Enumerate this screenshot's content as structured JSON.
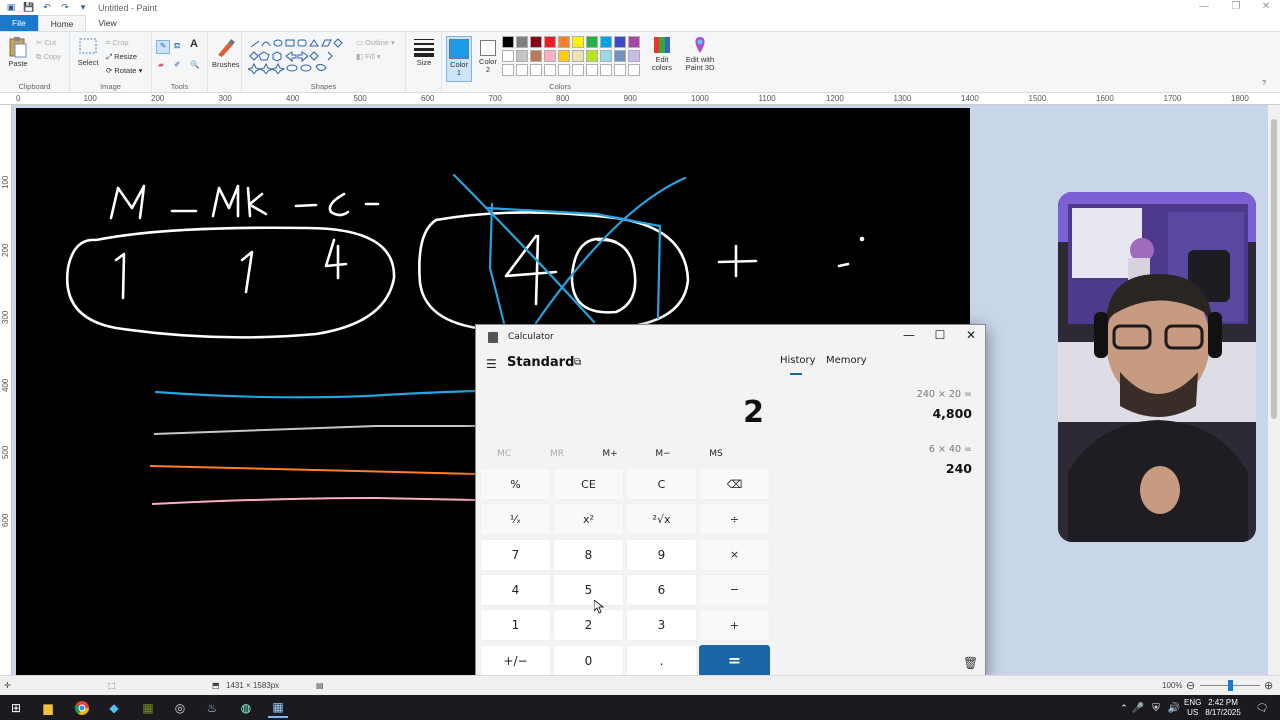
{
  "window_title": "Untitled - Paint",
  "ribbon": {
    "tabs": [
      "File",
      "Home",
      "View"
    ],
    "clipboard": {
      "paste": "Paste",
      "cut": "Cut",
      "copy": "Copy",
      "label": "Clipboard"
    },
    "image": {
      "select": "Select",
      "crop": "Crop",
      "resize": "Resize",
      "rotate": "Rotate",
      "label": "Image"
    },
    "tools": {
      "label": "Tools"
    },
    "brushes": {
      "label": "Brushes"
    },
    "shapes": {
      "outline": "Outline",
      "fill": "Fill",
      "label": "Shapes"
    },
    "size": {
      "label": "Size"
    },
    "color1": {
      "label": "Color",
      "num": "1"
    },
    "color2": {
      "label": "Color",
      "num": "2"
    },
    "colors": {
      "label": "Colors",
      "edit": "Edit colors",
      "paint3d": "Edit with Paint 3D"
    },
    "palette_row1": [
      "#000000",
      "#7f7f7f",
      "#880015",
      "#ed1c24",
      "#ff7f27",
      "#fff200",
      "#22b14c",
      "#00a2e8",
      "#3f48cc",
      "#a349a4"
    ],
    "palette_row2": [
      "#ffffff",
      "#c3c3c3",
      "#b97a57",
      "#ffaec9",
      "#ffc90e",
      "#efe4b0",
      "#b5e61d",
      "#99d9ea",
      "#7092be",
      "#c8bfe7"
    ],
    "color1_value": "#1e9be6",
    "color2_value": "#ffffff"
  },
  "ruler_h_ticks": [
    "0",
    "100",
    "200",
    "300",
    "400",
    "500",
    "600",
    "700",
    "800",
    "900",
    "1000",
    "1100",
    "1200",
    "1300",
    "1400",
    "1500",
    "1600",
    "1700",
    "1800"
  ],
  "ruler_v_ticks": [
    "100",
    "200",
    "300",
    "400",
    "500",
    "600"
  ],
  "canvas_handwriting": {
    "top_text": "M — Mk — C —",
    "digits_left": [
      "1",
      "1",
      "4"
    ],
    "digits_right": "40",
    "plus": "+"
  },
  "status": {
    "canvas_size": "1431 × 1583px",
    "zoom": "100%"
  },
  "calculator": {
    "title": "Calculator",
    "mode": "Standard",
    "display": "2",
    "memory_buttons": [
      "MC",
      "MR",
      "M+",
      "M−",
      "MS"
    ],
    "keys": [
      [
        "%",
        "CE",
        "C",
        "⌫"
      ],
      [
        "¹⁄ₓ",
        "x²",
        "²√x",
        "÷"
      ],
      [
        "7",
        "8",
        "9",
        "×"
      ],
      [
        "4",
        "5",
        "6",
        "−"
      ],
      [
        "1",
        "2",
        "3",
        "+"
      ],
      [
        "+/−",
        "0",
        ".",
        "="
      ]
    ],
    "panel_tabs": [
      "History",
      "Memory"
    ],
    "history": [
      {
        "expression": "240 × 20 =",
        "result": "4,800"
      },
      {
        "expression": "6 × 40 =",
        "result": "240"
      }
    ]
  },
  "taskbar": {
    "tray_lang": "ENG",
    "tray_region": "US",
    "time": "2:42 PM",
    "date": "8/17/2025"
  }
}
